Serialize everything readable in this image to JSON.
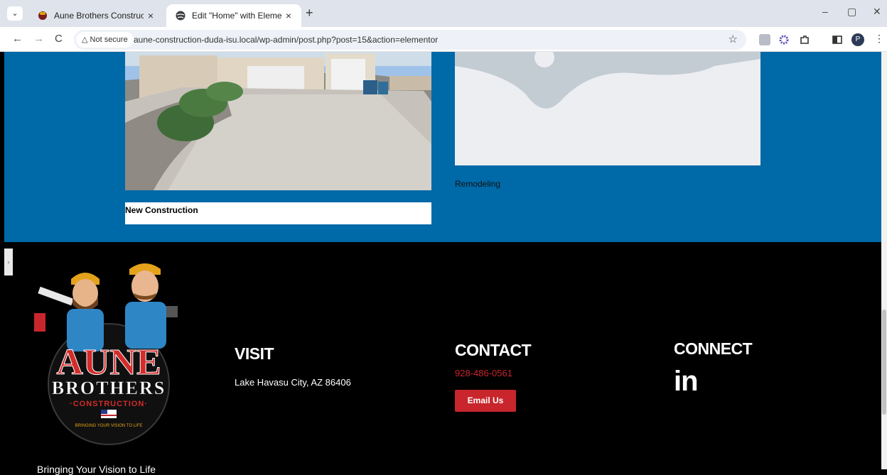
{
  "browser": {
    "tabs": [
      {
        "title": "Aune Brothers Construction",
        "icon": "aune-favicon"
      },
      {
        "title": "Edit \"Home\" with Elementor",
        "icon": "globe-icon"
      }
    ],
    "new_tab_label": "+",
    "close_glyph": "×",
    "min_glyph": "–",
    "restore_glyph": "▢",
    "winclose_glyph": "✕",
    "security_label": "△ Not secure",
    "url": "aune-construction-duda-isu.local/wp-admin/post.php?post=15&action=elementor",
    "star_glyph": "☆",
    "profile_initial": "P",
    "back_glyph": "←",
    "forward_glyph": "→",
    "reload_glyph": "C",
    "menu_glyph": "⋮",
    "tab_list_glyph": "⌄"
  },
  "services": {
    "new_construction": "New Construction",
    "remodeling": "Remodeling"
  },
  "footer": {
    "visit_heading": "VISIT",
    "address": "Lake Havasu City, AZ 86406",
    "contact_heading": "CONTACT",
    "phone": "928-486-0561",
    "email_button": "Email Us",
    "connect_heading": "CONNECT",
    "linkedin_label": "in",
    "tagline": "Bringing Your Vision to Life",
    "edge_glyph": "›",
    "logo": {
      "word1": "AUNE",
      "word2": "BROTHERS",
      "word3": "·CONSTRUCTION·",
      "slogan": "BRINGING YOUR VISION TO LIFE"
    }
  },
  "colors": {
    "section_blue": "#0069a8",
    "accent_red": "#c9252c",
    "footer_black": "#000000"
  }
}
